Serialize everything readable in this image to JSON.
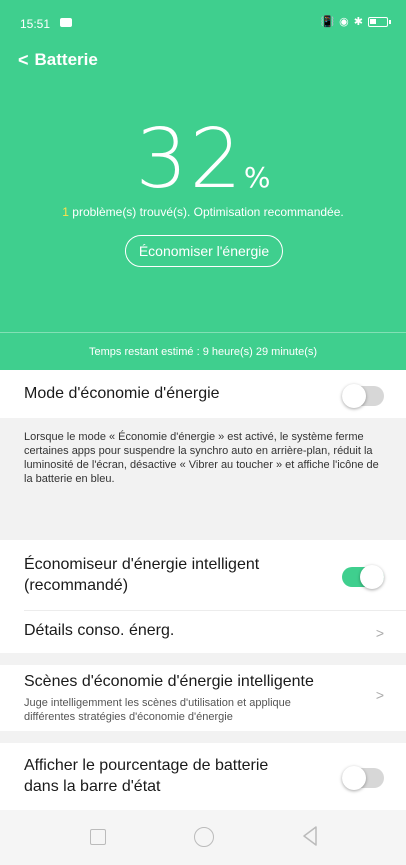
{
  "status_bar": {
    "time": "15:51"
  },
  "header": {
    "back_label": "<",
    "title": "Batterie"
  },
  "battery": {
    "percent": "32",
    "percent_symbol": "%",
    "problem_count": "1",
    "problem_text": " problème(s) trouvé(s). Optimisation recommandée.",
    "save_button": "Économiser l'énergie",
    "remaining_time": "Temps restant estimé : 9 heure(s) 29 minute(s)"
  },
  "settings": {
    "power_saving_mode": {
      "label": "Mode d'économie d'énergie",
      "enabled": false
    },
    "power_saving_description": "Lorsque le mode « Économie d'énergie » est activé, le système ferme certaines apps pour suspendre la synchro auto en arrière-plan, réduit la luminosité de l'écran, désactive « Vibrer au toucher » et affiche l'icône de la batterie en bleu.",
    "smart_saver": {
      "label_line1": "Économiseur d'énergie intelligent",
      "label_line2": "(recommandé)",
      "enabled": true
    },
    "consumption_details": {
      "label": "Détails conso. énerg.",
      "chevron": ">"
    },
    "smart_scenes": {
      "label": "Scènes d'économie d'énergie intelligente",
      "sub_line1": "Juge intelligemment les scènes d'utilisation et applique",
      "sub_line2": "différentes stratégies d'économie d'énergie",
      "chevron": ">"
    },
    "show_percentage": {
      "label_line1": "Afficher le pourcentage de batterie",
      "label_line2": "dans la barre d'état",
      "enabled": false
    }
  },
  "colors": {
    "accent": "#3fcf8e",
    "problem_highlight": "#ffe14a",
    "section_gray": "#f2f2f2"
  }
}
